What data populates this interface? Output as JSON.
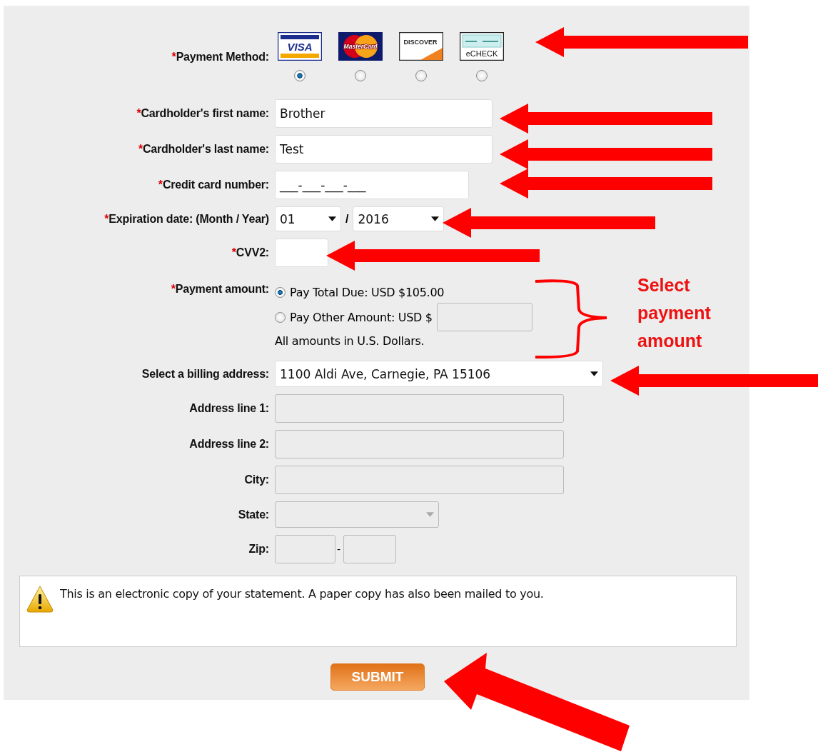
{
  "payment_method": {
    "required_mark": "*",
    "label": "Payment Method:",
    "options": [
      {
        "label": "VISA",
        "kind": "visa",
        "selected": true
      },
      {
        "label": "MasterCard",
        "kind": "mastercard",
        "selected": false
      },
      {
        "label": "DISCOVER",
        "kind": "discover",
        "selected": false
      },
      {
        "label": "eCHECK",
        "kind": "echeck",
        "selected": false
      }
    ]
  },
  "fields": [
    {
      "kind": "text",
      "required_mark": "*",
      "label": "Cardholder's first name:",
      "value": "Brother",
      "disabled": false
    },
    {
      "kind": "text",
      "required_mark": "*",
      "label": "Cardholder's last name:",
      "value": "Test",
      "disabled": false
    },
    {
      "kind": "text",
      "required_mark": "*",
      "label": "Credit card number:",
      "value": "___-___-___-___",
      "disabled": false
    },
    {
      "kind": "date",
      "required_mark": "*",
      "label": "Expiration date: (Month / Year)",
      "month": "01",
      "separator": "/",
      "year": "2016"
    },
    {
      "kind": "text",
      "required_mark": "*",
      "label": "CVV2:",
      "disabled": false
    },
    {
      "kind": "amount",
      "required_mark": "*",
      "label": "Payment amount:",
      "options": [
        {
          "label": "Pay Total Due: USD $105.00",
          "selected": true,
          "has_input": false
        },
        {
          "label": "Pay Other Amount: USD $",
          "selected": false,
          "has_input": true
        }
      ],
      "note": "All amounts in U.S. Dollars."
    },
    {
      "kind": "select",
      "label": "Select a billing address:",
      "value": "1100 Aldi Ave, Carnegie, PA 15106",
      "disabled": false
    },
    {
      "kind": "text",
      "label": "Address line 1:",
      "disabled": true
    },
    {
      "kind": "text",
      "label": "Address line 2:",
      "disabled": true
    },
    {
      "kind": "text",
      "label": "City:",
      "disabled": true
    },
    {
      "kind": "select",
      "label": "State:",
      "disabled": true
    },
    {
      "kind": "zip",
      "label": "Zip:",
      "separator": "-"
    }
  ],
  "notice": {
    "text": "This is an electronic copy of your statement. A paper copy has also been mailed to you."
  },
  "submit": {
    "label": "SUBMIT"
  },
  "annotations": {
    "callout": "Select payment amount"
  }
}
